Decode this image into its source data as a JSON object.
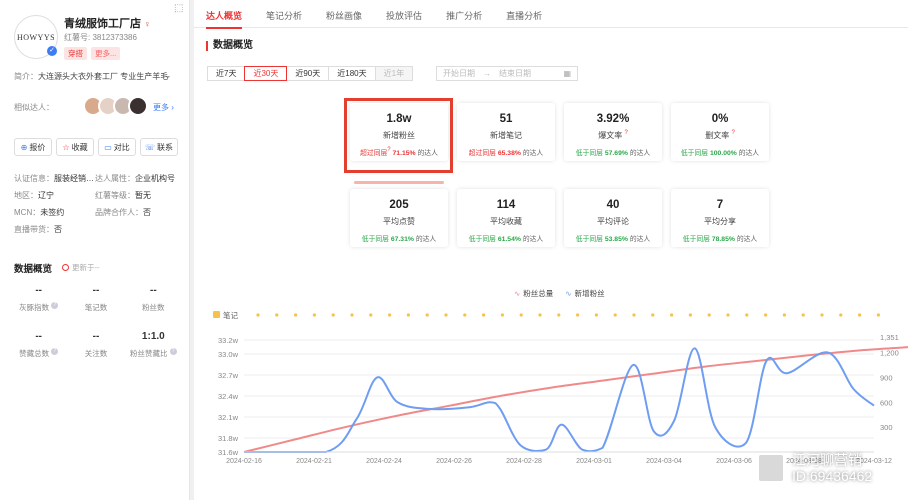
{
  "profile": {
    "logo_text": "HOWYYS",
    "verified_mark": "✓",
    "name": "青绒服饰工厂店",
    "account": "红薯号: 3812373386",
    "tag_primary": "穿搭",
    "tag_more": "更多...",
    "intro_label": "简介：",
    "intro_text": "大连源头大衣外套工厂 专业生产羊毛",
    "similar_label": "相似达人：",
    "similar_more": "更多",
    "corner_icon": "share-icon"
  },
  "actions": [
    {
      "icon": "⊕",
      "label": "报价"
    },
    {
      "icon": "☆",
      "label": "收藏"
    },
    {
      "icon": "▭",
      "label": "对比"
    },
    {
      "icon": "☏",
      "label": "联系"
    }
  ],
  "info_rows": [
    {
      "k1": "认证信息：",
      "v1": "服装经销…",
      "k2": "达人属性：",
      "v2": "企业机构号"
    },
    {
      "k1": "地区：",
      "v1": "辽宁",
      "k2": "红薯等级：",
      "v2": "暂无"
    },
    {
      "k1": "MCN：",
      "v1": "未签约",
      "k2": "品牌合作人：",
      "v2": "否"
    },
    {
      "k1": "直播带货：",
      "v1": "否",
      "k2": "",
      "v2": ""
    }
  ],
  "left_overview": {
    "title": "数据概览",
    "update": "更新于--",
    "stats": [
      {
        "value": "--",
        "label": "灰豚指数"
      },
      {
        "value": "--",
        "label": "笔记数"
      },
      {
        "value": "--",
        "label": "粉丝数"
      },
      {
        "value": "--",
        "label": "赞藏总数"
      },
      {
        "value": "--",
        "label": "关注数"
      },
      {
        "value": "1:1.0",
        "label": "粉丝赞藏比"
      }
    ]
  },
  "tabs": [
    "达人概览",
    "笔记分析",
    "粉丝画像",
    "投放评估",
    "推广分析",
    "直播分析"
  ],
  "section_title": "数据概览",
  "ranges": [
    "近7天",
    "近30天",
    "近90天",
    "近180天",
    "近1年"
  ],
  "date_range": {
    "start": "开始日期",
    "arrow": "→",
    "end": "结束日期",
    "icon": "▦"
  },
  "cards": [
    {
      "value": "1.8w",
      "label": "新增粉丝",
      "cmp": "超过同层",
      "pct": "71.15%",
      "suffix": "的达人"
    },
    {
      "value": "51",
      "label": "新增笔记",
      "cmp": "超过同层",
      "pct": "65.38%",
      "suffix": "的达人"
    },
    {
      "value": "3.92%",
      "label": "爆文率",
      "cmp": "低于同层",
      "pct": "57.69%",
      "suffix": "的达人"
    },
    {
      "value": "0%",
      "label": "删文率",
      "cmp": "低于同层",
      "pct": "100.00%",
      "suffix": "的达人"
    },
    {
      "value": "205",
      "label": "平均点赞",
      "cmp": "低于同层",
      "pct": "67.31%",
      "suffix": "的达人"
    },
    {
      "value": "114",
      "label": "平均收藏",
      "cmp": "低于同层",
      "pct": "61.54%",
      "suffix": "的达人"
    },
    {
      "value": "40",
      "label": "平均评论",
      "cmp": "低于同层",
      "pct": "53.85%",
      "suffix": "的达人"
    },
    {
      "value": "7",
      "label": "平均分享",
      "cmp": "低于同层",
      "pct": "78.85%",
      "suffix": "的达人"
    }
  ],
  "legend": {
    "total": "粉丝总量",
    "new": "新增粉丝",
    "note": "笔记"
  },
  "colors": {
    "accent": "#e33f2e",
    "total_line": "#f08a8a",
    "new_line": "#6f9df2",
    "note_dot": "#f5c34a",
    "up": "#e33333",
    "down": "#2aa84a"
  },
  "watermark": {
    "line1": "江河聊营销",
    "line2": "ID:69436462"
  },
  "chart_data": {
    "type": "line",
    "x": [
      "2024-02-16",
      "2024-02-21",
      "2024-02-24",
      "2024-02-26",
      "2024-02-28",
      "2024-03-01",
      "2024-03-04",
      "2024-03-06",
      "2024-03-08",
      "2024-03-12"
    ],
    "x_labels_shown": [
      "2024-02-16",
      "2024-02-21",
      "2024-02-24",
      "2024-02-26",
      "2024-02-28",
      "2024-03-01",
      "2024-03-04",
      "2024-03-06",
      "2024-03-08",
      "2024-03-12"
    ],
    "left_axis": {
      "ticks": [
        "31.6w",
        "31.8w",
        "32.1w",
        "32.4w",
        "32.7w",
        "33.0w",
        "33.2w"
      ],
      "range": [
        31.6,
        33.2
      ]
    },
    "right_axis": {
      "ticks": [
        300,
        600,
        900,
        1200,
        1351
      ],
      "range": [
        0,
        1351
      ]
    },
    "series": [
      {
        "name": "粉丝总量",
        "axis": "left",
        "unit": "w",
        "points": [
          [
            0,
            31.6
          ],
          [
            1,
            31.78
          ],
          [
            2,
            31.96
          ],
          [
            3,
            32.12
          ],
          [
            4,
            32.26
          ],
          [
            5,
            32.4
          ],
          [
            6,
            32.52
          ],
          [
            7,
            32.62
          ],
          [
            8,
            32.72
          ],
          [
            9,
            32.82
          ],
          [
            10,
            32.9
          ],
          [
            11,
            32.98
          ],
          [
            12,
            33.05
          ],
          [
            13,
            33.1
          ],
          [
            14,
            33.16
          ],
          [
            15,
            33.2
          ]
        ]
      },
      {
        "name": "新增粉丝",
        "axis": "right",
        "points": [
          [
            0,
            0
          ],
          [
            1.6,
            0
          ],
          [
            2.2,
            400
          ],
          [
            2.6,
            900
          ],
          [
            3.0,
            600
          ],
          [
            3.6,
            520
          ],
          [
            4.4,
            540
          ],
          [
            4.8,
            600
          ],
          [
            5.0,
            520
          ],
          [
            5.4,
            80
          ],
          [
            5.9,
            30
          ],
          [
            6.2,
            330
          ],
          [
            6.6,
            30
          ],
          [
            7.0,
            50
          ],
          [
            7.6,
            1050
          ],
          [
            8.0,
            250
          ],
          [
            8.4,
            380
          ],
          [
            8.8,
            1250
          ],
          [
            9.2,
            300
          ],
          [
            9.8,
            110
          ],
          [
            10.2,
            1100
          ],
          [
            10.6,
            950
          ],
          [
            11.4,
            1200
          ],
          [
            11.9,
            760
          ],
          [
            12.3,
            560
          ]
        ]
      }
    ],
    "x_range": [
      0,
      12.3
    ],
    "grid": true,
    "legend_position": "top-center"
  }
}
